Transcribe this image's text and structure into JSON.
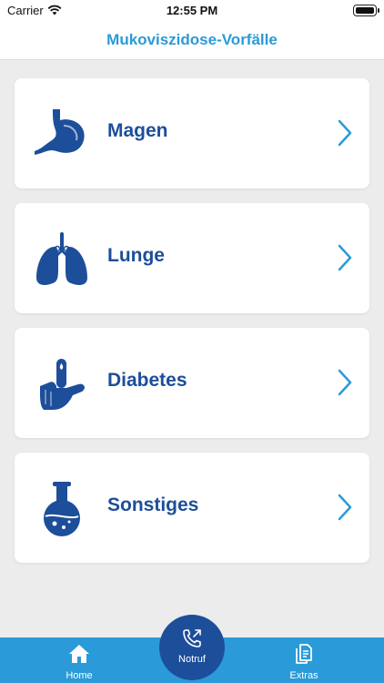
{
  "status": {
    "carrier": "Carrier",
    "time": "12:55 PM"
  },
  "nav": {
    "title": "Mukoviszidose-Vorfälle"
  },
  "categories": [
    {
      "label": "Magen",
      "icon": "stomach-icon"
    },
    {
      "label": "Lunge",
      "icon": "lungs-icon"
    },
    {
      "label": "Diabetes",
      "icon": "finger-drop-icon"
    },
    {
      "label": "Sonstiges",
      "icon": "flask-icon"
    }
  ],
  "tabs": {
    "home": {
      "label": "Home",
      "icon": "home-icon"
    },
    "notruf": {
      "label": "Notruf",
      "icon": "phone-outgoing-icon"
    },
    "extras": {
      "label": "Extras",
      "icon": "documents-icon"
    }
  },
  "colors": {
    "accent": "#2a9ad8",
    "brand": "#1d4e9a",
    "background": "#ececec"
  }
}
